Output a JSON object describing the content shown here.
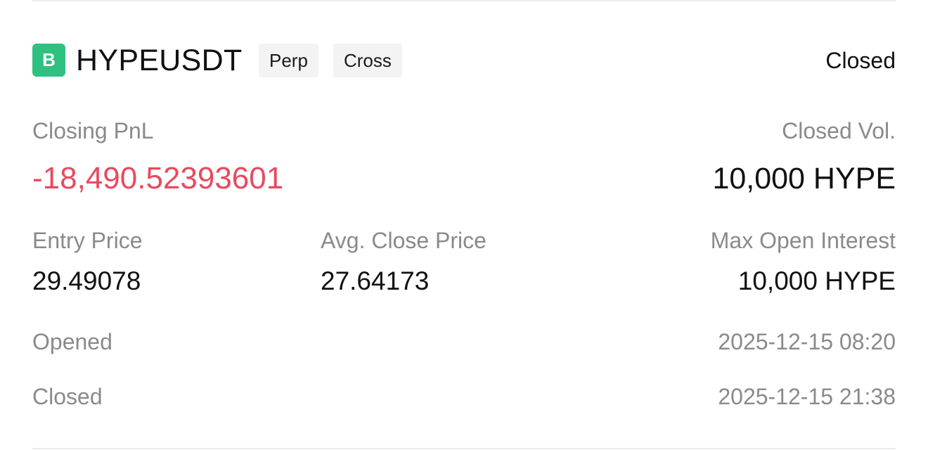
{
  "position": {
    "badge_letter": "B",
    "badge_color": "#2ec17f",
    "symbol": "HYPEUSDT",
    "tags": [
      "Perp",
      "Cross"
    ],
    "status": "Closed"
  },
  "pnl": {
    "label": "Closing PnL",
    "value": "-18,490.52393601",
    "color": "#e84a5f"
  },
  "closed_vol": {
    "label": "Closed Vol.",
    "value": "10,000 HYPE"
  },
  "metrics": {
    "entry_price": {
      "label": "Entry Price",
      "value": "29.49078"
    },
    "avg_close_price": {
      "label": "Avg. Close Price",
      "value": "27.64173"
    },
    "max_open_interest": {
      "label": "Max Open Interest",
      "value": "10,000 HYPE"
    }
  },
  "times": {
    "opened": {
      "label": "Opened",
      "value": "2025-12-15 08:20"
    },
    "closed": {
      "label": "Closed",
      "value": "2025-12-15 21:38"
    }
  }
}
